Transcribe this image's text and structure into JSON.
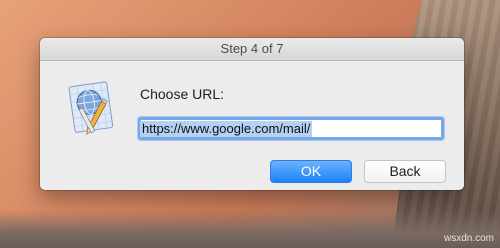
{
  "dialog": {
    "title": "Step 4 of 7",
    "prompt": "Choose URL:",
    "url_value": "https://www.google.com/mail/",
    "ok_label": "OK",
    "back_label": "Back",
    "app_icon": "script-editor-icon"
  },
  "watermark": "wsxdn.com",
  "colors": {
    "ok_button": "#1a82fb",
    "focus_ring": "#7aa7e8",
    "selection": "#b3d0f5"
  }
}
